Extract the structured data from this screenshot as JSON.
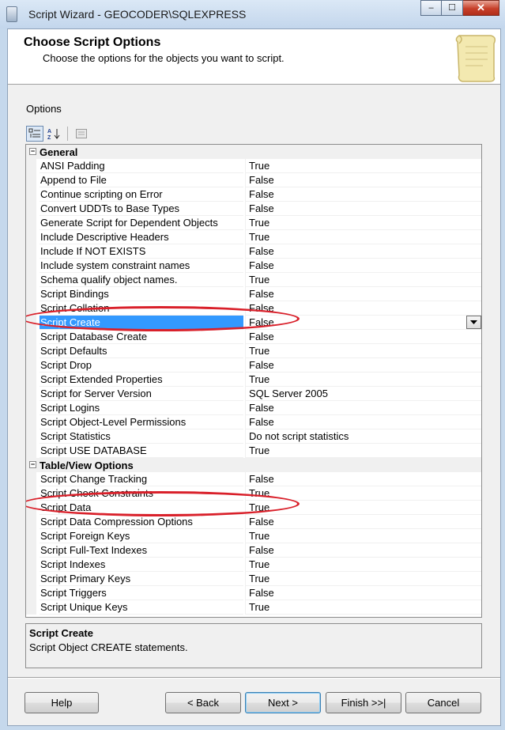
{
  "window": {
    "title": "Script Wizard - GEOCODER\\SQLEXPRESS",
    "minimize_label": "–",
    "maximize_label": "☐",
    "close_label": "✕"
  },
  "header": {
    "title": "Choose Script Options",
    "subtitle": "Choose the options for the objects you want to script."
  },
  "options_label": "Options",
  "grid": {
    "categories": [
      {
        "name": "General",
        "expander": "−",
        "properties": [
          {
            "name": "ANSI Padding",
            "value": "True"
          },
          {
            "name": "Append to File",
            "value": "False"
          },
          {
            "name": "Continue scripting on Error",
            "value": "False"
          },
          {
            "name": "Convert UDDTs to Base Types",
            "value": "False"
          },
          {
            "name": "Generate Script for Dependent Objects",
            "value": "True"
          },
          {
            "name": "Include Descriptive Headers",
            "value": "True"
          },
          {
            "name": "Include If NOT EXISTS",
            "value": "False"
          },
          {
            "name": "Include system constraint names",
            "value": "False"
          },
          {
            "name": "Schema qualify object names.",
            "value": "True"
          },
          {
            "name": "Script Bindings",
            "value": "False"
          },
          {
            "name": "Script Collation",
            "value": "False"
          },
          {
            "name": "Script Create",
            "value": "False"
          },
          {
            "name": "Script Database Create",
            "value": "False"
          },
          {
            "name": "Script Defaults",
            "value": "True"
          },
          {
            "name": "Script Drop",
            "value": "False"
          },
          {
            "name": "Script Extended Properties",
            "value": "True"
          },
          {
            "name": "Script for Server Version",
            "value": "SQL Server 2005"
          },
          {
            "name": "Script Logins",
            "value": "False"
          },
          {
            "name": "Script Object-Level Permissions",
            "value": "False"
          },
          {
            "name": "Script Statistics",
            "value": "Do not script statistics"
          },
          {
            "name": "Script USE DATABASE",
            "value": "True"
          }
        ]
      },
      {
        "name": "Table/View Options",
        "expander": "−",
        "properties": [
          {
            "name": "Script Change Tracking",
            "value": "False"
          },
          {
            "name": "Script Check Constraints",
            "value": "True"
          },
          {
            "name": "Script Data",
            "value": "True"
          },
          {
            "name": "Script Data Compression Options",
            "value": "False"
          },
          {
            "name": "Script Foreign Keys",
            "value": "True"
          },
          {
            "name": "Script Full-Text Indexes",
            "value": "False"
          },
          {
            "name": "Script Indexes",
            "value": "True"
          },
          {
            "name": "Script Primary Keys",
            "value": "True"
          },
          {
            "name": "Script Triggers",
            "value": "False"
          },
          {
            "name": "Script Unique Keys",
            "value": "True"
          }
        ]
      }
    ],
    "selected_property": "Script Create",
    "highlighted_properties": [
      "Script Create",
      "Script Data"
    ]
  },
  "description": {
    "title": "Script Create",
    "text": "Script Object CREATE statements."
  },
  "buttons": {
    "help": "Help",
    "back": "< Back",
    "next": "Next >",
    "finish": "Finish >>|",
    "cancel": "Cancel"
  },
  "colors": {
    "selection": "#3399ff",
    "annotation": "#d9202a"
  }
}
